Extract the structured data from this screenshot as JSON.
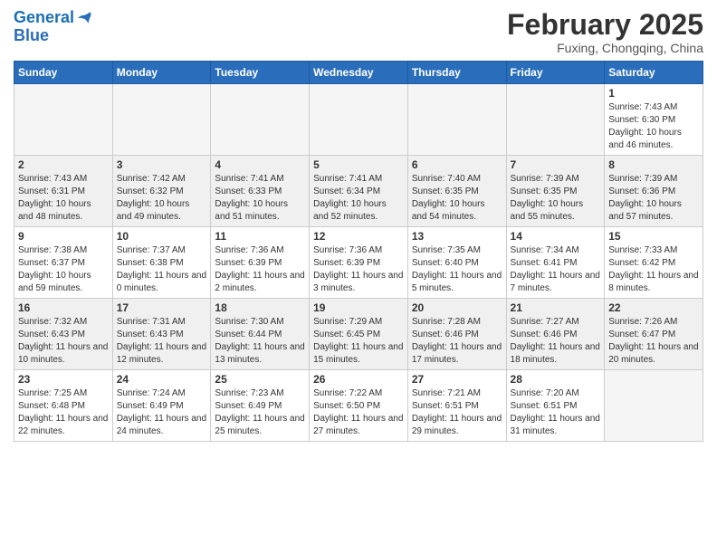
{
  "header": {
    "logo_line1": "General",
    "logo_line2": "Blue",
    "cal_title": "February 2025",
    "cal_subtitle": "Fuxing, Chongqing, China"
  },
  "weekdays": [
    "Sunday",
    "Monday",
    "Tuesday",
    "Wednesday",
    "Thursday",
    "Friday",
    "Saturday"
  ],
  "weeks": [
    [
      {
        "day": "",
        "info": ""
      },
      {
        "day": "",
        "info": ""
      },
      {
        "day": "",
        "info": ""
      },
      {
        "day": "",
        "info": ""
      },
      {
        "day": "",
        "info": ""
      },
      {
        "day": "",
        "info": ""
      },
      {
        "day": "1",
        "info": "Sunrise: 7:43 AM\nSunset: 6:30 PM\nDaylight: 10 hours and 46 minutes."
      }
    ],
    [
      {
        "day": "2",
        "info": "Sunrise: 7:43 AM\nSunset: 6:31 PM\nDaylight: 10 hours and 48 minutes."
      },
      {
        "day": "3",
        "info": "Sunrise: 7:42 AM\nSunset: 6:32 PM\nDaylight: 10 hours and 49 minutes."
      },
      {
        "day": "4",
        "info": "Sunrise: 7:41 AM\nSunset: 6:33 PM\nDaylight: 10 hours and 51 minutes."
      },
      {
        "day": "5",
        "info": "Sunrise: 7:41 AM\nSunset: 6:34 PM\nDaylight: 10 hours and 52 minutes."
      },
      {
        "day": "6",
        "info": "Sunrise: 7:40 AM\nSunset: 6:35 PM\nDaylight: 10 hours and 54 minutes."
      },
      {
        "day": "7",
        "info": "Sunrise: 7:39 AM\nSunset: 6:35 PM\nDaylight: 10 hours and 55 minutes."
      },
      {
        "day": "8",
        "info": "Sunrise: 7:39 AM\nSunset: 6:36 PM\nDaylight: 10 hours and 57 minutes."
      }
    ],
    [
      {
        "day": "9",
        "info": "Sunrise: 7:38 AM\nSunset: 6:37 PM\nDaylight: 10 hours and 59 minutes."
      },
      {
        "day": "10",
        "info": "Sunrise: 7:37 AM\nSunset: 6:38 PM\nDaylight: 11 hours and 0 minutes."
      },
      {
        "day": "11",
        "info": "Sunrise: 7:36 AM\nSunset: 6:39 PM\nDaylight: 11 hours and 2 minutes."
      },
      {
        "day": "12",
        "info": "Sunrise: 7:36 AM\nSunset: 6:39 PM\nDaylight: 11 hours and 3 minutes."
      },
      {
        "day": "13",
        "info": "Sunrise: 7:35 AM\nSunset: 6:40 PM\nDaylight: 11 hours and 5 minutes."
      },
      {
        "day": "14",
        "info": "Sunrise: 7:34 AM\nSunset: 6:41 PM\nDaylight: 11 hours and 7 minutes."
      },
      {
        "day": "15",
        "info": "Sunrise: 7:33 AM\nSunset: 6:42 PM\nDaylight: 11 hours and 8 minutes."
      }
    ],
    [
      {
        "day": "16",
        "info": "Sunrise: 7:32 AM\nSunset: 6:43 PM\nDaylight: 11 hours and 10 minutes."
      },
      {
        "day": "17",
        "info": "Sunrise: 7:31 AM\nSunset: 6:43 PM\nDaylight: 11 hours and 12 minutes."
      },
      {
        "day": "18",
        "info": "Sunrise: 7:30 AM\nSunset: 6:44 PM\nDaylight: 11 hours and 13 minutes."
      },
      {
        "day": "19",
        "info": "Sunrise: 7:29 AM\nSunset: 6:45 PM\nDaylight: 11 hours and 15 minutes."
      },
      {
        "day": "20",
        "info": "Sunrise: 7:28 AM\nSunset: 6:46 PM\nDaylight: 11 hours and 17 minutes."
      },
      {
        "day": "21",
        "info": "Sunrise: 7:27 AM\nSunset: 6:46 PM\nDaylight: 11 hours and 18 minutes."
      },
      {
        "day": "22",
        "info": "Sunrise: 7:26 AM\nSunset: 6:47 PM\nDaylight: 11 hours and 20 minutes."
      }
    ],
    [
      {
        "day": "23",
        "info": "Sunrise: 7:25 AM\nSunset: 6:48 PM\nDaylight: 11 hours and 22 minutes."
      },
      {
        "day": "24",
        "info": "Sunrise: 7:24 AM\nSunset: 6:49 PM\nDaylight: 11 hours and 24 minutes."
      },
      {
        "day": "25",
        "info": "Sunrise: 7:23 AM\nSunset: 6:49 PM\nDaylight: 11 hours and 25 minutes."
      },
      {
        "day": "26",
        "info": "Sunrise: 7:22 AM\nSunset: 6:50 PM\nDaylight: 11 hours and 27 minutes."
      },
      {
        "day": "27",
        "info": "Sunrise: 7:21 AM\nSunset: 6:51 PM\nDaylight: 11 hours and 29 minutes."
      },
      {
        "day": "28",
        "info": "Sunrise: 7:20 AM\nSunset: 6:51 PM\nDaylight: 11 hours and 31 minutes."
      },
      {
        "day": "",
        "info": ""
      }
    ]
  ]
}
